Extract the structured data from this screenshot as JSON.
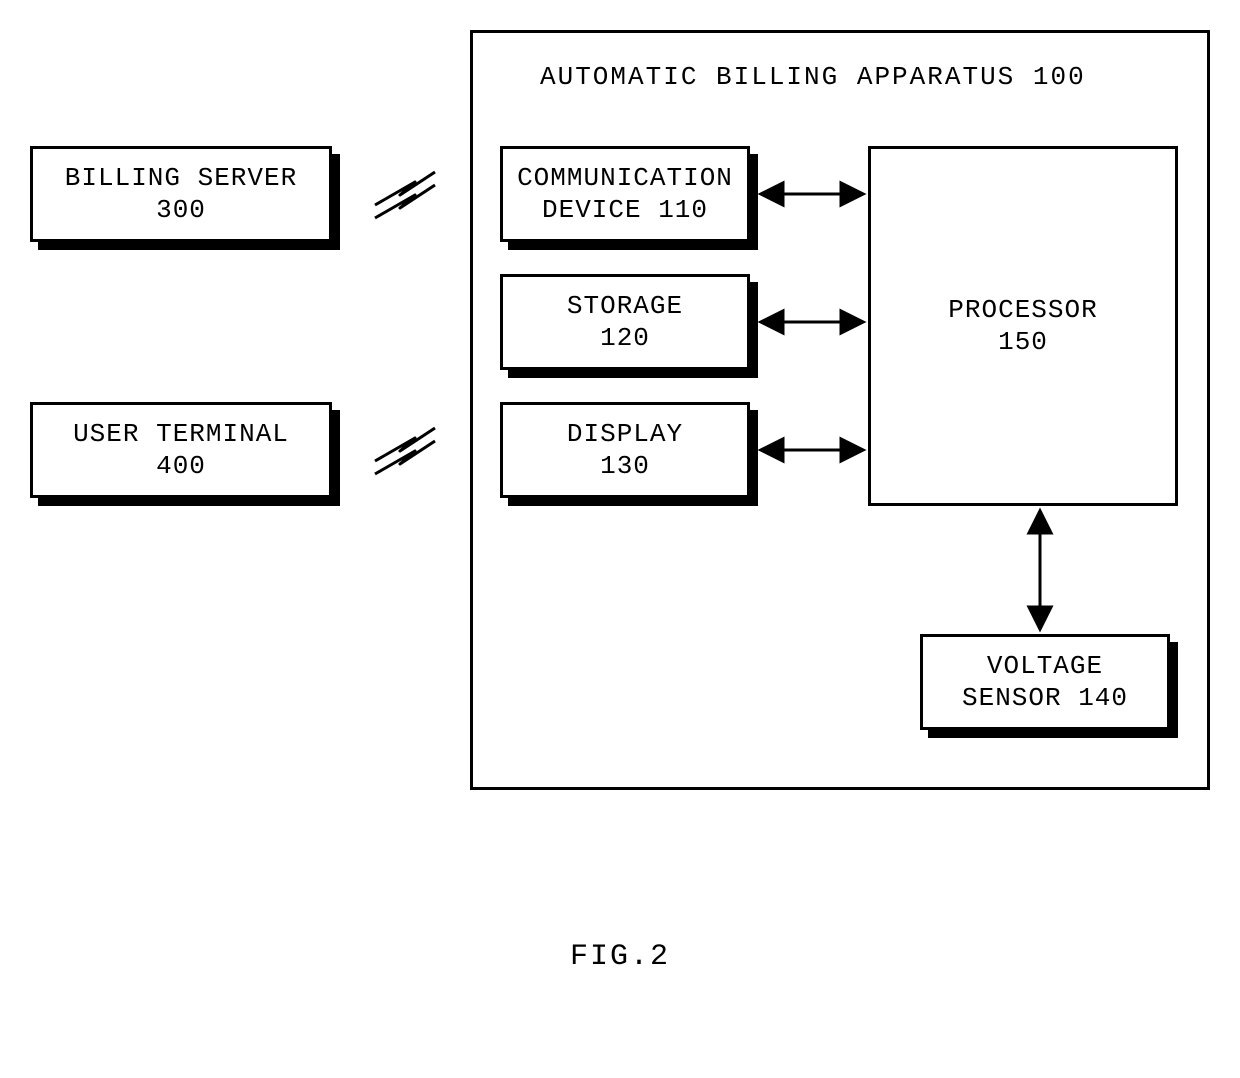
{
  "external": {
    "billing_server": {
      "label": "BILLING SERVER",
      "num": "300"
    },
    "user_terminal": {
      "label": "USER TERMINAL",
      "num": "400"
    }
  },
  "apparatus": {
    "title": "AUTOMATIC BILLING APPARATUS 100",
    "comm": {
      "label": "COMMUNICATION",
      "sub": "DEVICE 110"
    },
    "storage": {
      "label": "STORAGE",
      "num": "120"
    },
    "display": {
      "label": "DISPLAY",
      "num": "130"
    },
    "voltage": {
      "label": "VOLTAGE",
      "sub": "SENSOR 140"
    },
    "processor": {
      "label": "PROCESSOR",
      "num": "150"
    }
  },
  "caption": "FIG.2"
}
